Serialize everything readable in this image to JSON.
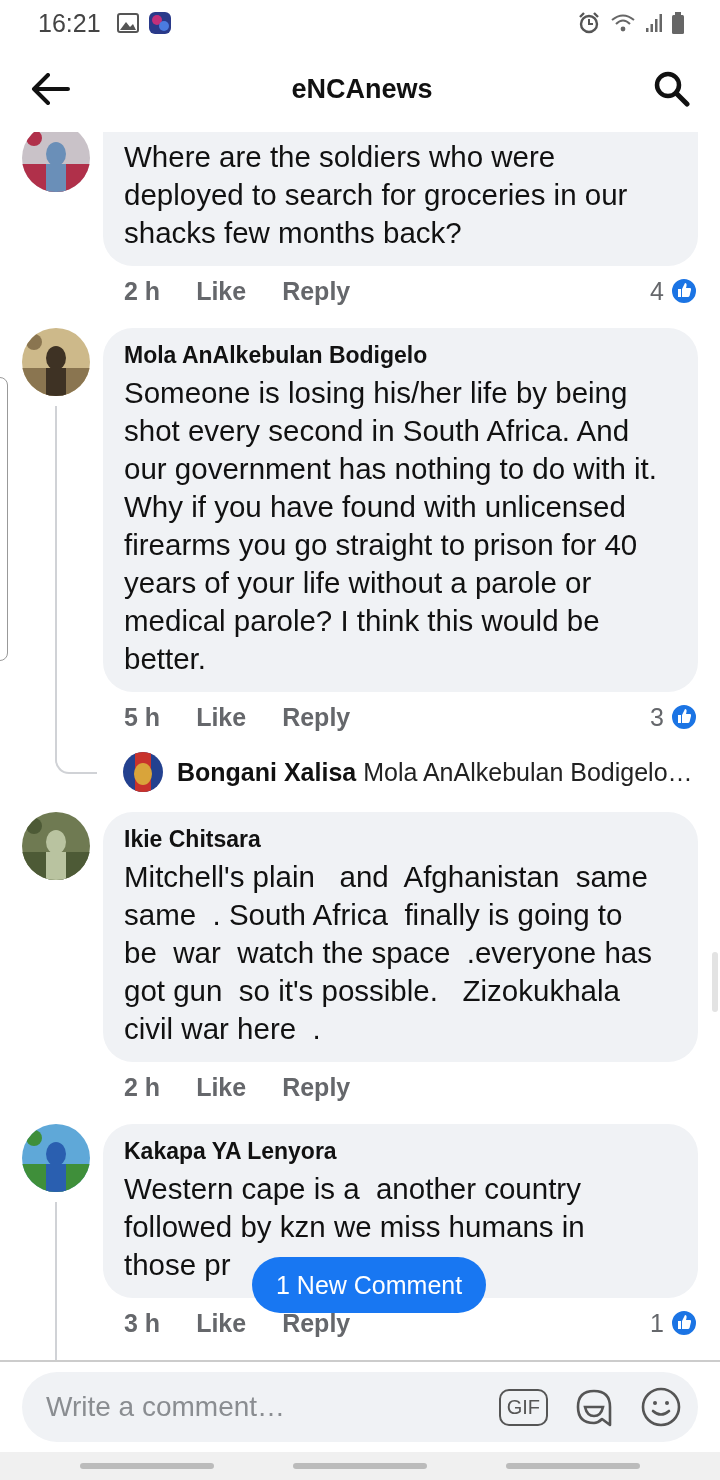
{
  "status_bar": {
    "time": "16:21"
  },
  "header": {
    "title": "eNCAnews"
  },
  "comments": [
    {
      "body": "Where are the soldiers who were deployed to search for groceries in our shacks few months back?",
      "time": "2 h",
      "like": "Like",
      "reply": "Reply",
      "likes": "4",
      "thread": false,
      "cut_top": true
    },
    {
      "author": "Mola AnAlkebulan Bodigelo",
      "body": "Someone is losing his/her life by being shot every second in South Africa. And our government has nothing to do with it. Why if you have found with unlicensed firearms you go straight to prison for 40 years of your life without a parole or medical parole? I think this would be better.",
      "time": "5 h",
      "like": "Like",
      "reply": "Reply",
      "likes": "3",
      "thread": true,
      "cut_top": false,
      "replies": [
        {
          "author": "Bongani Xalisa",
          "text": "Mola AnAlkebulan Bodigelo…"
        }
      ]
    },
    {
      "author": "Ikie Chitsara",
      "body": "Mitchell's plain   and  Afghanistan  same same  . South Africa  finally is going to be  war  watch the space  .everyone has got gun  so it's possible.   Zizokukhala civil war here  .",
      "time": "2 h",
      "like": "Like",
      "reply": "Reply",
      "thread": false,
      "cut_top": false
    },
    {
      "author": "Kakapa YA Lenyora",
      "body": "Western cape is a  another country followed by kzn we miss humans in those pr",
      "time": "3 h",
      "like": "Like",
      "reply": "Reply",
      "likes": "1",
      "thread": true,
      "cut_top": false
    }
  ],
  "new_comment_pill": "1 New Comment",
  "composer": {
    "placeholder": "Write a comment…",
    "gif": "GIF"
  }
}
